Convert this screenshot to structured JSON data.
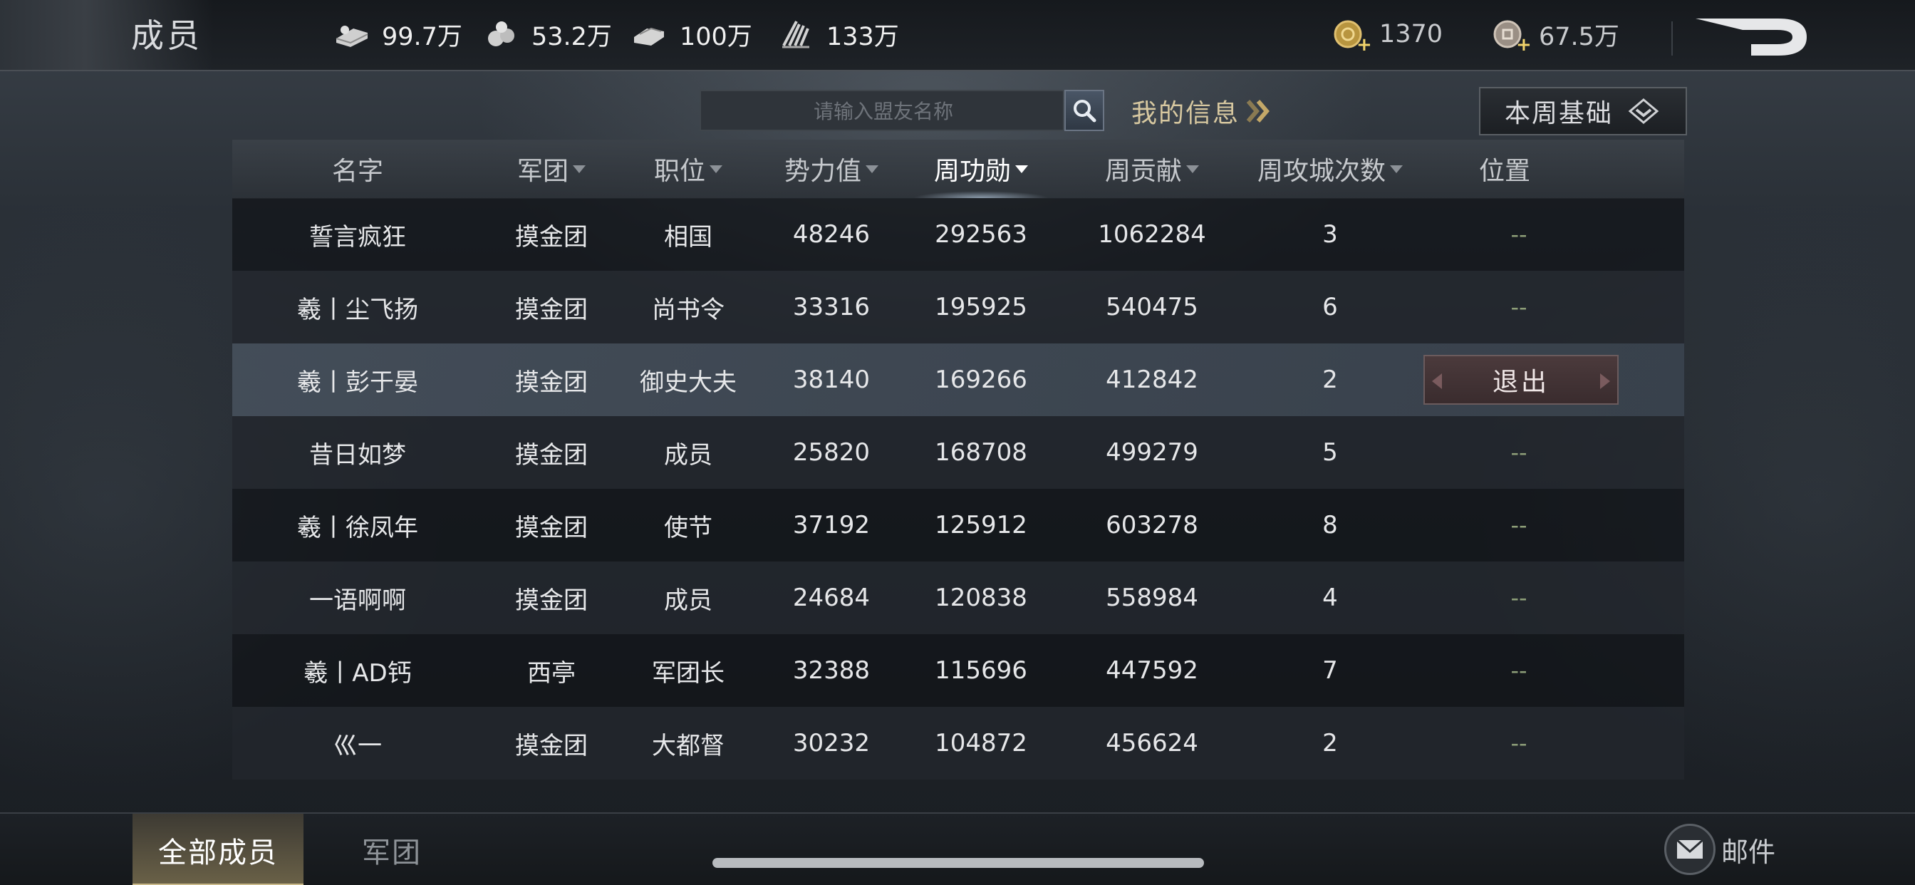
{
  "header": {
    "title": "成员",
    "resources": [
      {
        "name": "wood-icon",
        "value": "99.7万"
      },
      {
        "name": "stone-icon",
        "value": "53.2万"
      },
      {
        "name": "iron-icon",
        "value": "100万"
      },
      {
        "name": "grain-icon",
        "value": "133万"
      }
    ],
    "currencies": [
      {
        "name": "gold-coin-icon",
        "value": "1370"
      },
      {
        "name": "copper-coin-icon",
        "value": "67.5万"
      }
    ]
  },
  "search": {
    "placeholder": "请输入盟友名称"
  },
  "my_info_label": "我的信息",
  "week_filter_label": "本周基础",
  "table": {
    "columns": [
      {
        "label": "名字",
        "sortable": false
      },
      {
        "label": "军团",
        "sortable": true
      },
      {
        "label": "职位",
        "sortable": true
      },
      {
        "label": "势力值",
        "sortable": true
      },
      {
        "label": "周功勋",
        "sortable": true,
        "active": true
      },
      {
        "label": "周贡献",
        "sortable": true
      },
      {
        "label": "周攻城次数",
        "sortable": true
      },
      {
        "label": "位置",
        "sortable": false
      }
    ],
    "rows": [
      {
        "name": "誓言疯狂",
        "legion": "摸金团",
        "rank": "相国",
        "power": "48246",
        "merit": "292563",
        "contribution": "1062284",
        "sieges": "3",
        "position": "--"
      },
      {
        "name": "羲丨尘飞扬",
        "legion": "摸金团",
        "rank": "尚书令",
        "power": "33316",
        "merit": "195925",
        "contribution": "540475",
        "sieges": "6",
        "position": "--"
      },
      {
        "name": "羲丨彭于晏",
        "legion": "摸金团",
        "rank": "御史大夫",
        "power": "38140",
        "merit": "169266",
        "contribution": "412842",
        "sieges": "2",
        "position": "退出",
        "selected": true
      },
      {
        "name": "昔日如梦",
        "legion": "摸金团",
        "rank": "成员",
        "power": "25820",
        "merit": "168708",
        "contribution": "499279",
        "sieges": "5",
        "position": "--"
      },
      {
        "name": "羲丨徐凤年",
        "legion": "摸金团",
        "rank": "使节",
        "power": "37192",
        "merit": "125912",
        "contribution": "603278",
        "sieges": "8",
        "position": "--"
      },
      {
        "name": "一语啊啊",
        "legion": "摸金团",
        "rank": "成员",
        "power": "24684",
        "merit": "120838",
        "contribution": "558984",
        "sieges": "4",
        "position": "--"
      },
      {
        "name": "羲丨AD钙",
        "legion": "西亭",
        "rank": "军团长",
        "power": "32388",
        "merit": "115696",
        "contribution": "447592",
        "sieges": "7",
        "position": "--"
      },
      {
        "name": "巛一",
        "legion": "摸金团",
        "rank": "大都督",
        "power": "30232",
        "merit": "104872",
        "contribution": "456624",
        "sieges": "2",
        "position": "--"
      }
    ]
  },
  "bottom": {
    "tabs": [
      {
        "label": "全部成员",
        "active": true
      },
      {
        "label": "军团",
        "active": false
      }
    ],
    "mail_label": "邮件"
  },
  "colors": {
    "accent_gold": "#d7c8a0",
    "position_dash": "#8d9e78",
    "exit_button": "#4b3a3c"
  }
}
